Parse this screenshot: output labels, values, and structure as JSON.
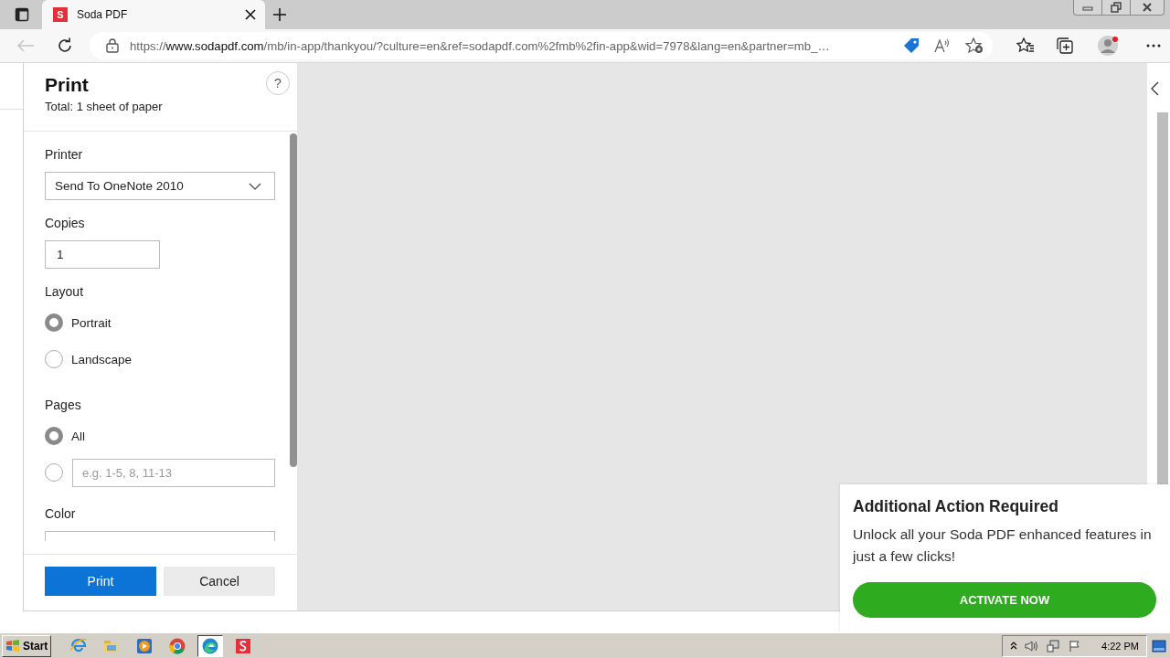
{
  "browser": {
    "tab": {
      "title": "Soda PDF",
      "favicon": "S",
      "selected": true
    },
    "back": {
      "disabled": true
    },
    "address": {
      "scheme": "https://",
      "host": "www.sodapdf.com",
      "path": "/mb/in-app/thankyou/?culture=en&ref=sodapdf.com%2fmb%2fin-app&wid=7978&lang=en&partner=mb_…"
    }
  },
  "print_dialog": {
    "title": "Print",
    "summary": "Total: 1 sheet of paper",
    "help": "?",
    "sections": [
      {
        "kind": "select",
        "label": "Printer",
        "value": "Send To OneNote 2010"
      },
      {
        "kind": "number",
        "label": "Copies",
        "value": "1"
      },
      {
        "kind": "radios",
        "label": "Layout",
        "options": [
          {
            "label": "Portrait",
            "selected": true
          },
          {
            "label": "Landscape",
            "selected": false
          }
        ]
      },
      {
        "kind": "radios",
        "label": "Pages",
        "options": [
          {
            "label": "All",
            "selected": true
          },
          {
            "placeholder": "e.g. 1-5, 8, 11-13",
            "selected": false
          }
        ]
      },
      {
        "kind": "cut",
        "label": "Color"
      }
    ],
    "buttons": [
      {
        "label": "Print",
        "kind": "primary"
      },
      {
        "label": "Cancel",
        "kind": "secondary"
      }
    ]
  },
  "toast": {
    "title": "Additional Action Required",
    "message": "Unlock all your Soda PDF enhanced features in just a few clicks!",
    "action": "ACTIVATE NOW"
  },
  "taskbar": {
    "start": "Start",
    "apps": [
      {
        "kind": "ie",
        "selected": false
      },
      {
        "kind": "folder",
        "selected": false
      },
      {
        "kind": "media",
        "selected": false
      },
      {
        "kind": "chrome",
        "selected": false
      },
      {
        "kind": "edge",
        "selected": true
      },
      {
        "kind": "soda",
        "selected": false
      }
    ],
    "clock": "4:22 PM"
  }
}
